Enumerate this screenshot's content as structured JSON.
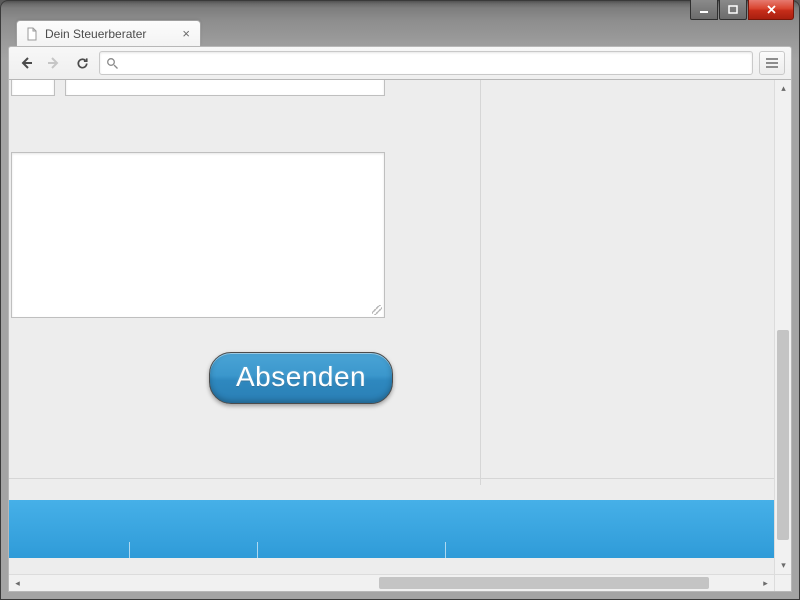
{
  "window": {
    "controls": {
      "minimize": "–",
      "maximize": "❐",
      "close": "✕"
    }
  },
  "browser": {
    "tab": {
      "title": "Dein Steuerberater"
    },
    "omnibox": {
      "value": ""
    }
  },
  "form": {
    "submit_label": "Absenden"
  }
}
